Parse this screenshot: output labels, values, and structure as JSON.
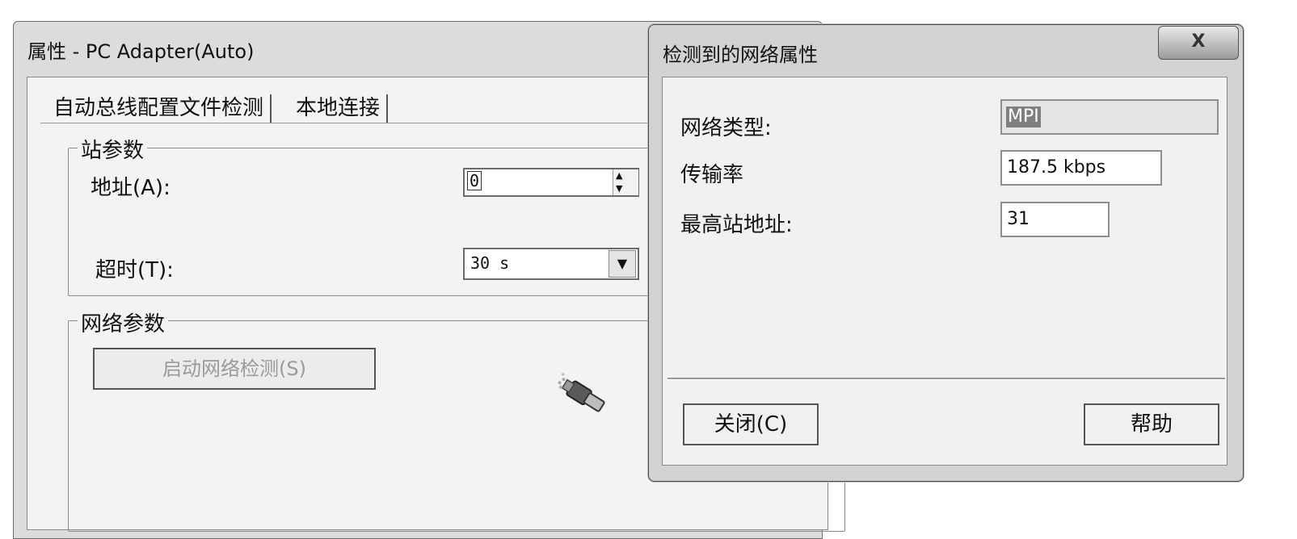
{
  "back_window": {
    "title": "属性 - PC Adapter(Auto)",
    "tabs": [
      {
        "label": "自动总线配置文件检测"
      },
      {
        "label": "本地连接"
      }
    ],
    "station_group": {
      "legend": "站参数",
      "address_label": "地址(A):",
      "address_value": "0",
      "timeout_label": "超时(T):",
      "timeout_value": "30 s"
    },
    "network_group": {
      "legend": "网络参数",
      "start_detect_label": "启动网络检测(S)"
    }
  },
  "dialog": {
    "title": "检测到的网络属性",
    "close_glyph": "X",
    "properties": {
      "network_type_label": "网络类型:",
      "network_type_value": "MPI",
      "rate_label": "传输率",
      "rate_value": "187.5 kbps",
      "max_address_label": "最高站地址:",
      "max_address_value": "31"
    },
    "buttons": {
      "close_label": "关闭(C)",
      "help_label": "帮助"
    }
  },
  "icons": {
    "spin_up": "▲",
    "spin_down": "▼",
    "dropdown": "▼",
    "adapter": "network-adapter-icon"
  }
}
